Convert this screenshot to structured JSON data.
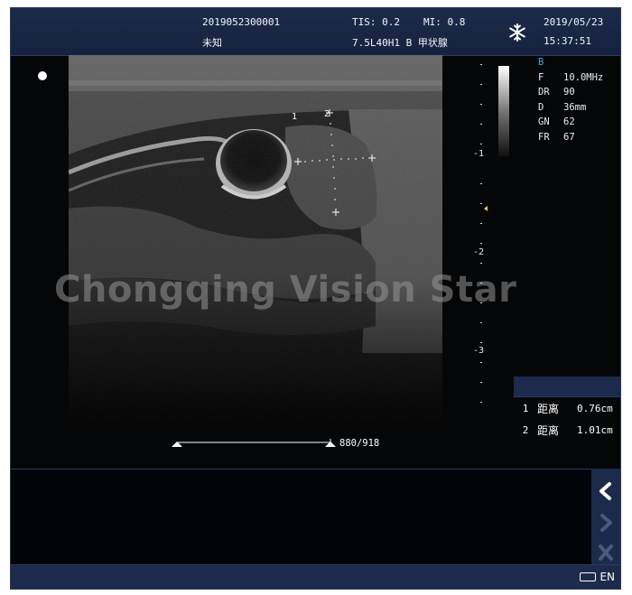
{
  "header": {
    "exam_id": "2019052300001",
    "patient_name": "未知",
    "tis": "TIS: 0.2",
    "mi": "MI: 0.8",
    "probe_preset": "7.5L40H1 B 甲状腺",
    "date": "2019/05/23",
    "time": "15:37:51",
    "freeze_icon": "snowflake-icon"
  },
  "params": {
    "mode": "B",
    "items": [
      {
        "key": "F",
        "value": "10.0MHz"
      },
      {
        "key": "DR",
        "value": "90"
      },
      {
        "key": "D",
        "value": "36mm"
      },
      {
        "key": "GN",
        "value": "62"
      },
      {
        "key": "FR",
        "value": "67"
      }
    ]
  },
  "depth_scale": {
    "labels": [
      "-1",
      "-2",
      "-3"
    ]
  },
  "markers": {
    "caliper_1": "1",
    "caliper_2": "2"
  },
  "measurements": [
    {
      "index": "1",
      "label": "距离",
      "value": "0.76cm"
    },
    {
      "index": "2",
      "label": "距离",
      "value": "1.01cm"
    }
  ],
  "cine": {
    "frames": "880/918"
  },
  "statusbar": {
    "language": "EN"
  },
  "watermark": "Chongqing Vision Star",
  "colors": {
    "bar_bg": "#1c2b4b",
    "accent_mode": "#4aa3d8",
    "marker_yellow": "#e8d14a"
  }
}
